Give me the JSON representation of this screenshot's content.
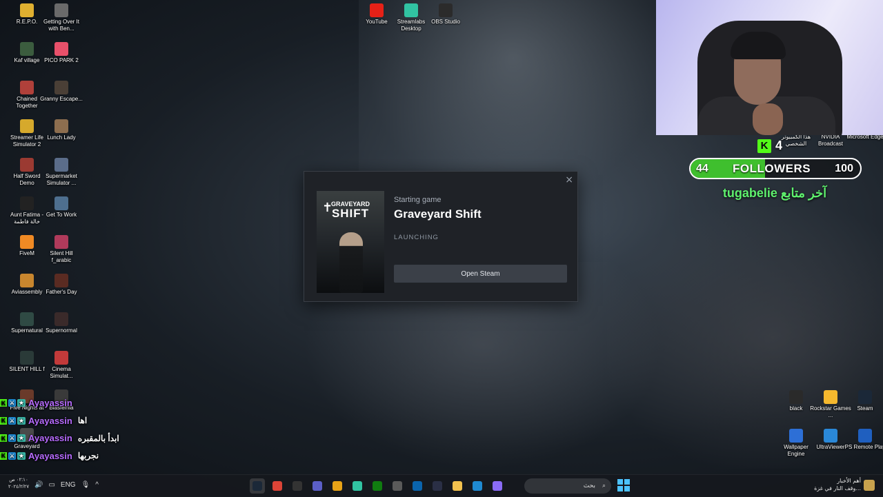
{
  "desktop": {
    "left_icons": [
      {
        "label": "R.E.P.O.",
        "icon": "repo-game-icon",
        "color": "#e0b030"
      },
      {
        "label": "Getting Over It with Ben...",
        "icon": "getting-over-it-icon",
        "color": "#6a6a6a"
      },
      {
        "label": "Kaf village",
        "icon": "kaf-village-icon",
        "color": "#3b5c3e"
      },
      {
        "label": "PICO PARK 2",
        "icon": "pico-park-icon",
        "color": "#e8506a"
      },
      {
        "label": "Chained Together",
        "icon": "chained-together-icon",
        "color": "#b0403a"
      },
      {
        "label": "Granny Escape...",
        "icon": "granny-escape-icon",
        "color": "#4a3f36"
      },
      {
        "label": "Streamer Life Simulator 2",
        "icon": "streamer-life-icon",
        "color": "#d6a92c"
      },
      {
        "label": "Lunch Lady",
        "icon": "lunch-lady-icon",
        "color": "#8d6e4f"
      },
      {
        "label": "Half Sword Demo",
        "icon": "half-sword-icon",
        "color": "#9b3a32"
      },
      {
        "label": "Supermarket Simulator ...",
        "icon": "supermarket-icon",
        "color": "#5b6d8a"
      },
      {
        "label": "Aunt Fatima - خالة فاطمة",
        "icon": "aunt-fatima-icon",
        "color": "#222222"
      },
      {
        "label": "Get To Work",
        "icon": "get-to-work-icon",
        "color": "#4e6f8f"
      },
      {
        "label": "FiveM",
        "icon": "fivem-icon",
        "color": "#f08a24"
      },
      {
        "label": "Silent Hill f_arabic",
        "icon": "silent-hill-arabic-icon",
        "color": "#b03a5b"
      },
      {
        "label": "Aviassembly",
        "icon": "aviassembly-icon",
        "color": "#c8862e"
      },
      {
        "label": "Father's Day",
        "icon": "fathers-day-icon",
        "color": "#5a2b22"
      },
      {
        "label": "Supernatural",
        "icon": "supernatural-icon",
        "color": "#2f4a44"
      },
      {
        "label": "Supernormal",
        "icon": "supernormal-icon",
        "color": "#3a2a2a"
      },
      {
        "label": "SILENT HILL f",
        "icon": "silent-hill-f-icon",
        "color": "#2a3a38"
      },
      {
        "label": "Cinema Simulat...",
        "icon": "cinema-simulator-icon",
        "color": "#c23a3a"
      },
      {
        "label": "Five Nights at",
        "icon": "five-nights-icon",
        "color": "#6a3a2a"
      },
      {
        "label": "Blasfemia",
        "icon": "blasfemia-icon",
        "color": "#3a3a3a"
      },
      {
        "label": "Graveyard",
        "icon": "graveyard-icon",
        "color": "#4a4a4a"
      }
    ],
    "top_icons": [
      {
        "label": "YouTube",
        "icon": "youtube-icon",
        "color": "#e62117"
      },
      {
        "label": "Streamlabs Desktop",
        "icon": "streamlabs-icon",
        "color": "#31c3a2"
      },
      {
        "label": "OBS Studio",
        "icon": "obs-icon",
        "color": "#2b2b2b"
      }
    ],
    "right_top_icons": [
      {
        "label": "هذا الكمبيوتر الشخصي",
        "icon": "this-pc-icon",
        "color": "#4a90d9"
      },
      {
        "label": "NVIDIA Broadcast",
        "icon": "nvidia-broadcast-icon",
        "color": "#76b900"
      },
      {
        "label": "Microsoft Edge",
        "icon": "edge-icon",
        "color": "#1f8ad2"
      }
    ],
    "right_bottom_icons": [
      {
        "label": "black",
        "icon": "black-folder-icon",
        "color": "#2a2a2a"
      },
      {
        "label": "Rockstar Games ...",
        "icon": "rockstar-icon",
        "color": "#f5b82e"
      },
      {
        "label": "Steam",
        "icon": "steam-icon",
        "color": "#1b2838"
      },
      {
        "label": "Wallpaper Engine",
        "icon": "wallpaper-engine-icon",
        "color": "#2d6fd6"
      },
      {
        "label": "UltraViewer",
        "icon": "ultraviewer-icon",
        "color": "#2a88d8"
      },
      {
        "label": "PS Remote Play",
        "icon": "ps-remote-play-icon",
        "color": "#1f5fbf"
      }
    ]
  },
  "overlay": {
    "kick_viewers": "4",
    "followers_current": "44",
    "followers_label": "FOLLOWERS",
    "followers_goal": "100",
    "followers_progress": 0.44,
    "latest_follower": "tugabelie آخر متابع",
    "kick_color": "#53fc18"
  },
  "dialog": {
    "subtitle": "Starting game",
    "title": "Graveyard Shift",
    "status": "LAUNCHING",
    "button": "Open Steam",
    "close": "×",
    "cover_top": "GRAVEYARD",
    "cover_big": "SHIFT"
  },
  "chat": [
    {
      "user": "Ayayassin",
      "message": ""
    },
    {
      "user": "Ayayassin",
      "message": "اها"
    },
    {
      "user": "Ayayassin",
      "message": "ابدأ بالمقبره"
    },
    {
      "user": "Ayayassin",
      "message": "نجربها"
    }
  ],
  "taskbar": {
    "time": "٠٢:١٠ ص",
    "date": "٢٠٢٤/٢/٢٧",
    "lang": "ENG",
    "search_text": "بحث",
    "news_line1": "أهم الأخبار",
    "news_line2": "وقف النار في غزة...",
    "apps": [
      {
        "icon": "steam-icon",
        "color": "#1b2838",
        "active": true
      },
      {
        "icon": "chrome-icon",
        "color": "#db4437"
      },
      {
        "icon": "obs-icon",
        "color": "#333333"
      },
      {
        "icon": "teams-icon",
        "color": "#5b5fc7"
      },
      {
        "icon": "chrome-alt-icon",
        "color": "#e8a317"
      },
      {
        "icon": "streamlabs-icon",
        "color": "#31c3a2"
      },
      {
        "icon": "xbox-icon",
        "color": "#107c10"
      },
      {
        "icon": "usb-icon",
        "color": "#5a5a5a"
      },
      {
        "icon": "outlook-icon",
        "color": "#0a64ad"
      },
      {
        "icon": "store-icon",
        "color": "#2a2f45"
      },
      {
        "icon": "file-explorer-icon",
        "color": "#f2c14e"
      },
      {
        "icon": "edge-icon",
        "color": "#1f8ad2"
      },
      {
        "icon": "copilot-icon",
        "color": "#8a6bf5"
      }
    ]
  }
}
